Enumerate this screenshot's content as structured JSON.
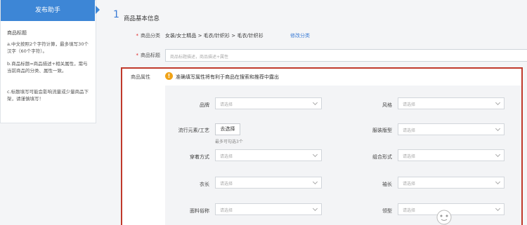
{
  "sidebar": {
    "header": "发布助手",
    "section_title": "商品标题",
    "tips": [
      "a.中文按照2个字符计算，最多填写30个汉字（60个字符）。",
      "b.商品标题=商品描述+相关属性，需与当前商品的分类、属性一致。",
      "c.标题填写可能会影响流量或少量商品下架，请谨慎填写！"
    ]
  },
  "section": {
    "number": "1",
    "title": "商品基本信息"
  },
  "category": {
    "label": "商品分类",
    "path": "女装/女士精品 > 毛衣/针织衫 > 毛衣/针织衫",
    "edit": "修改分类"
  },
  "product_title": {
    "label": "商品标题",
    "placeholder": "商品标题描述，商品描述+属性"
  },
  "attributes": {
    "label": "商品属性",
    "warning": "准确填写属性将有利于商品在搜索和推荐中露出",
    "fields": {
      "brand": {
        "label": "品牌",
        "placeholder": "请选择"
      },
      "style": {
        "label": "风格",
        "placeholder": "请选择"
      },
      "craft": {
        "label": "流行元素/工艺",
        "button": "去选择",
        "hint": "最多可勾选3个"
      },
      "fit": {
        "label": "服装版型",
        "placeholder": "请选择"
      },
      "wear": {
        "label": "穿着方式",
        "placeholder": "请选择"
      },
      "combo": {
        "label": "组合形式",
        "placeholder": "请选择"
      },
      "length": {
        "label": "衣长",
        "placeholder": "请选择"
      },
      "sleeve": {
        "label": "袖长",
        "placeholder": "请选择"
      },
      "fabric": {
        "label": "面料俗称",
        "placeholder": "请选择"
      },
      "collar": {
        "label": "领型",
        "placeholder": "请选择"
      }
    }
  }
}
